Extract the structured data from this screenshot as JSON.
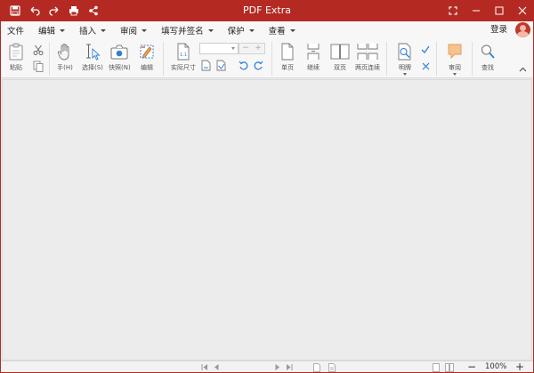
{
  "app": {
    "title": "PDF Extra"
  },
  "titlebar": {
    "quick_icons": [
      "save-icon",
      "undo-icon",
      "redo-icon",
      "print-icon",
      "share-icon"
    ],
    "window_buttons": [
      "fullscreen-icon",
      "minimize-icon",
      "maximize-icon",
      "close-icon"
    ]
  },
  "menu": {
    "items": [
      {
        "label": "文件",
        "dropdown": false
      },
      {
        "label": "编辑",
        "dropdown": true
      },
      {
        "label": "插入",
        "dropdown": true
      },
      {
        "label": "审阅",
        "dropdown": true
      },
      {
        "label": "填写并签名",
        "dropdown": true
      },
      {
        "label": "保护",
        "dropdown": true
      },
      {
        "label": "查看",
        "dropdown": true
      }
    ],
    "login": "登录"
  },
  "ribbon": {
    "paste": "粘贴",
    "hand": "手(H)",
    "select": "选择(S)",
    "snapshot": "快照(N)",
    "edit": "编辑",
    "actual_size": "实际尺寸",
    "zoom_minus": "−",
    "zoom_plus": "+",
    "single_page": "单页",
    "continuous": "继续",
    "two_page": "双页",
    "two_page_continuous": "两页连续",
    "redact": "明牌",
    "review": "审阅",
    "find": "查找"
  },
  "status": {
    "zoom": "100%",
    "minus": "−",
    "plus": "+"
  },
  "colors": {
    "brand_red": "#b42a22",
    "accent_blue": "#2f7fd6"
  }
}
